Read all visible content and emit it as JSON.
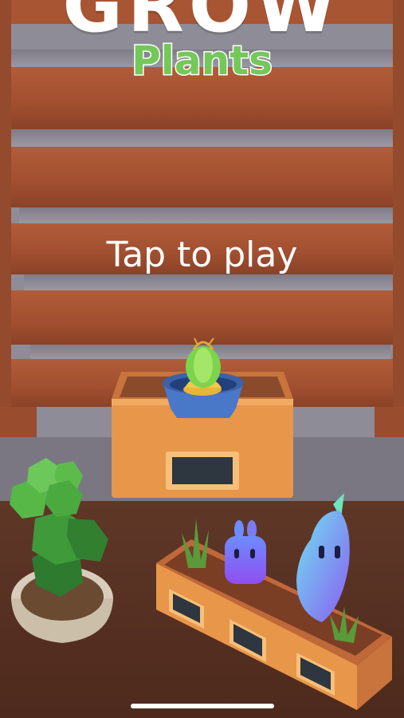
{
  "game": {
    "title_top": "GROW",
    "title_sub": "Plants",
    "prompt": "Tap to play"
  },
  "colors": {
    "wood": "#a85534",
    "title_green": "#74c85a",
    "pot_blue": "#4a78c8",
    "crate_orange": "#e8964a",
    "cactus_green": "#3f9a3a"
  }
}
